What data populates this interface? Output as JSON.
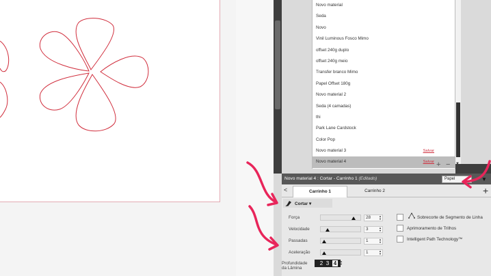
{
  "materials": [
    {
      "label": "Novo material",
      "save": ""
    },
    {
      "label": "Seda",
      "save": ""
    },
    {
      "label": "Novo",
      "save": ""
    },
    {
      "label": "Vinil Luminous Fosco Mimo",
      "save": ""
    },
    {
      "label": "offset 240g duplo",
      "save": ""
    },
    {
      "label": "offset 240g meio",
      "save": ""
    },
    {
      "label": "Transfer branco Mimo",
      "save": ""
    },
    {
      "label": "Papel Offset 180g",
      "save": ""
    },
    {
      "label": "Novo material 2",
      "save": ""
    },
    {
      "label": "Seda (4 camadas)",
      "save": ""
    },
    {
      "label": "thi",
      "save": ""
    },
    {
      "label": "Park Lane Cardstock",
      "save": ""
    },
    {
      "label": "Color Pop",
      "save": ""
    },
    {
      "label": "Novo material 3",
      "save": "Salvar"
    },
    {
      "label": "Novo material 4",
      "save": "Salvar",
      "selected": true
    }
  ],
  "list_controls": {
    "add": "+",
    "remove": "−",
    "down": "▼"
  },
  "header": {
    "title": "Novo material 4 : Cortar - Carrinho 1",
    "edited": "(Editado)",
    "paper_select": "Papel",
    "toggle": "▼"
  },
  "tabs": {
    "prev": "<",
    "tab1": "Carrinho 1",
    "tab2": "Carrinho 2",
    "add": "+"
  },
  "action": {
    "label": "Cortar ▾"
  },
  "settings": {
    "forca": {
      "label": "Força",
      "value": "28",
      "level": 0.85
    },
    "velocidade": {
      "label": "Velocidade",
      "value": "3",
      "level": 0.1
    },
    "passadas": {
      "label": "Passadas",
      "value": "1",
      "level": 0.0
    },
    "aceleracao": {
      "label": "Aceleração",
      "value": "1",
      "level": 0.0
    }
  },
  "options": {
    "sobrecorte": "Sobrecorte de Segmento de Linha",
    "aprimoramento": "Aprimoramento de Trilhos",
    "intelligent": "Intelligent Path Technology™"
  },
  "depth": {
    "label_line1": "Profundidade",
    "label_line2": "da Lâmina",
    "digits": [
      "2",
      "3",
      "4"
    ],
    "selected_digit": "4"
  },
  "colors": {
    "cut_line": "#d02b3a",
    "arrow": "#e8255a",
    "header_bg": "#585858"
  }
}
